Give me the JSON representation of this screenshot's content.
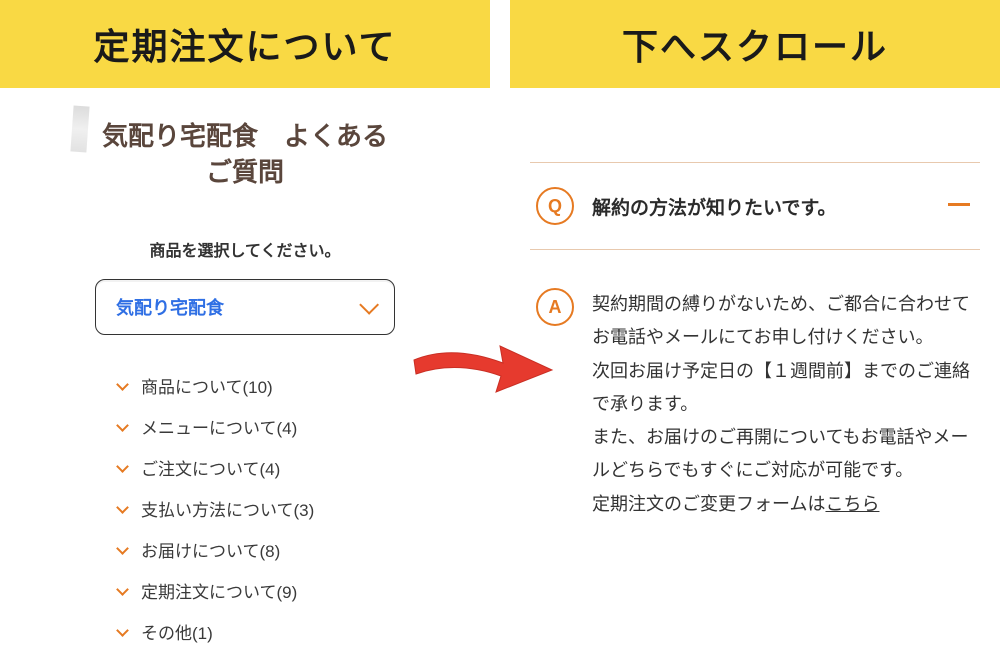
{
  "left": {
    "banner": "定期注文について",
    "faq_title": "気配り宅配食　よくあるご質問",
    "select_prompt": "商品を選択してください。",
    "select_value": "気配り宅配食",
    "categories": [
      {
        "label": "商品について(10)"
      },
      {
        "label": "メニューについて(4)"
      },
      {
        "label": "ご注文について(4)"
      },
      {
        "label": "支払い方法について(3)"
      },
      {
        "label": "お届けについて(8)"
      },
      {
        "label": "定期注文について(9)"
      },
      {
        "label": "その他(1)"
      }
    ]
  },
  "right": {
    "banner": "下へスクロール",
    "question": "解約の方法が知りたいです。",
    "answer_lines": [
      "契約期間の縛りがないため、ご都合に合わせてお電話やメールにてお申し付けください。",
      "次回お届け予定日の【１週間前】までのご連絡で承ります。",
      "また、お届けのご再開についてもお電話やメールどちらでもすぐにご対応が可能です。"
    ],
    "answer_link_prefix": "定期注文のご変更フォームは",
    "answer_link_text": "こちら",
    "badge_q": "Q",
    "badge_a": "A"
  },
  "colors": {
    "accent": "#e67a22",
    "banner_bg": "#f9d944",
    "link_blue": "#2f6fe4"
  }
}
